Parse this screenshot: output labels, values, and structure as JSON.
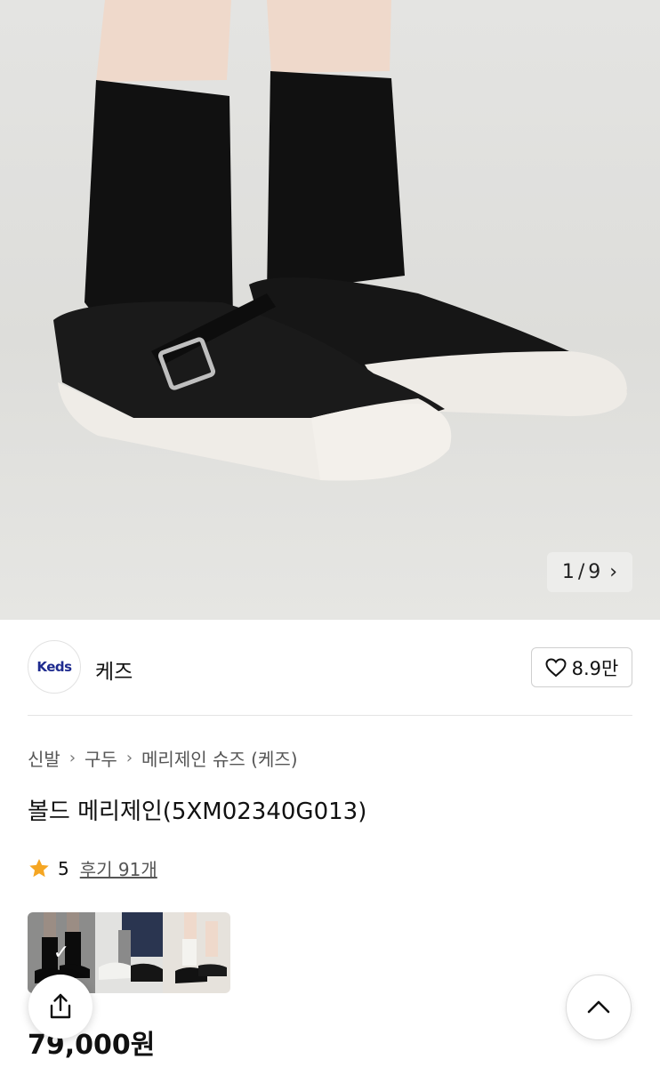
{
  "hero": {
    "image_alt": "product-photo",
    "pager_current": "1",
    "pager_sep": "/",
    "pager_total": "9",
    "next_icon": "chevron-right-icon"
  },
  "brand": {
    "logo_text": "Keds",
    "name": "케즈",
    "like_count": "8.9만",
    "like_icon": "heart-outline-icon"
  },
  "breadcrumb": [
    "신발",
    "구두",
    "메리제인 슈즈 (케즈)"
  ],
  "product": {
    "title": "볼드 메리제인(5XM02340G013)",
    "rating": "5",
    "reviews_label": "후기 91개",
    "price": "79,000원"
  },
  "colors": {
    "star": "#f5a623",
    "brand_logo": "#1e2b8f"
  }
}
